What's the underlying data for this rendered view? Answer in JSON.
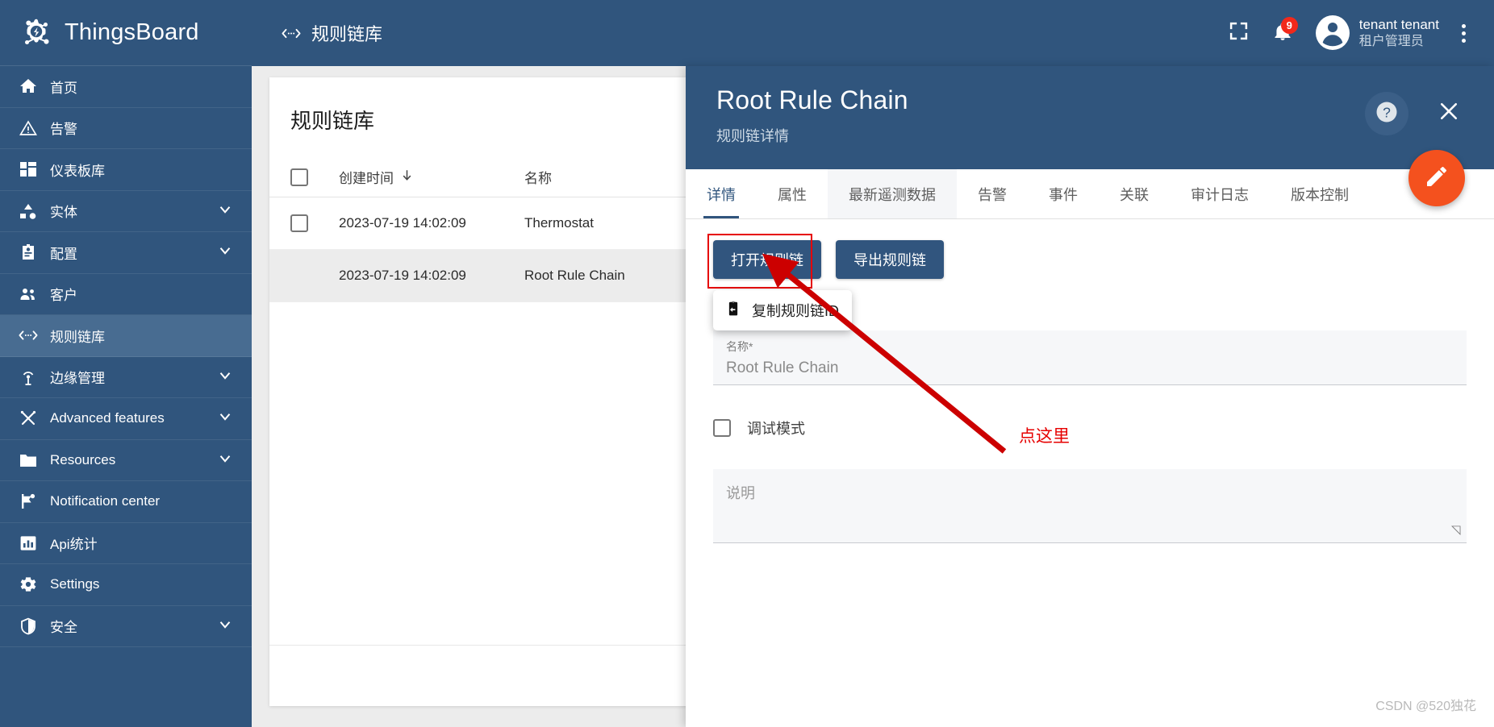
{
  "brand": {
    "name": "ThingsBoard",
    "logo_icon": "thingsboard-logo-icon"
  },
  "sidebar": {
    "items": [
      {
        "label": "首页",
        "icon": "home-icon",
        "expandable": false,
        "active": false
      },
      {
        "label": "告警",
        "icon": "alarm-warning-icon",
        "expandable": false,
        "active": false
      },
      {
        "label": "仪表板库",
        "icon": "dashboards-grid-icon",
        "expandable": false,
        "active": false
      },
      {
        "label": "实体",
        "icon": "entities-icon",
        "expandable": true,
        "active": false
      },
      {
        "label": "配置",
        "icon": "profiles-badge-icon",
        "expandable": true,
        "active": false
      },
      {
        "label": "客户",
        "icon": "customers-people-icon",
        "expandable": false,
        "active": false
      },
      {
        "label": "规则链库",
        "icon": "rule-chain-icon",
        "expandable": false,
        "active": true
      },
      {
        "label": "边缘管理",
        "icon": "edge-antenna-icon",
        "expandable": true,
        "active": false
      },
      {
        "label": "Advanced features",
        "icon": "tools-icon",
        "expandable": true,
        "active": false
      },
      {
        "label": "Resources",
        "icon": "folder-icon",
        "expandable": true,
        "active": false
      },
      {
        "label": "Notification center",
        "icon": "flag-icon",
        "expandable": false,
        "active": false
      },
      {
        "label": "Api统计",
        "icon": "bar-chart-icon",
        "expandable": false,
        "active": false
      },
      {
        "label": "Settings",
        "icon": "gear-icon",
        "expandable": false,
        "active": false
      },
      {
        "label": "安全",
        "icon": "shield-icon",
        "expandable": true,
        "active": false
      }
    ]
  },
  "topbar": {
    "title": "规则链库",
    "title_icon": "rule-chain-icon",
    "fullscreen_icon": "fullscreen-icon",
    "notifications_icon": "bell-icon",
    "notifications_count": "9",
    "avatar_icon": "user-avatar-icon",
    "user_name": "tenant tenant",
    "user_role": "租户管理员",
    "more_icon": "kebab-menu-icon"
  },
  "list_card": {
    "title": "规则链库",
    "columns": [
      "创建时间",
      "名称"
    ],
    "sort_icon": "arrow-down-icon",
    "rows": [
      {
        "created_time": "2023-07-19 14:02:09",
        "name": "Thermostat",
        "selected": false,
        "checkbox": true
      },
      {
        "created_time": "2023-07-19 14:02:09",
        "name": "Root Rule Chain",
        "selected": true,
        "checkbox": false
      }
    ]
  },
  "detail": {
    "title": "Root Rule Chain",
    "subtitle": "规则链详情",
    "help_icon": "help-question-icon",
    "close_icon": "close-icon",
    "edit_fab_icon": "pencil-edit-icon",
    "tabs": [
      {
        "label": "详情",
        "active": true
      },
      {
        "label": "属性",
        "active": false
      },
      {
        "label": "最新遥测数据",
        "active": false,
        "hover": true
      },
      {
        "label": "告警",
        "active": false
      },
      {
        "label": "事件",
        "active": false
      },
      {
        "label": "关联",
        "active": false
      },
      {
        "label": "审计日志",
        "active": false
      },
      {
        "label": "版本控制",
        "active": false
      }
    ],
    "buttons": {
      "open_rule_chain": "打开规则链",
      "export_rule_chain": "导出规则链",
      "copy_rule_chain_id": "复制规则链ID",
      "copy_icon": "clipboard-copy-icon"
    },
    "form": {
      "name_label": "名称*",
      "name_value": "Root Rule Chain",
      "debug_mode_label": "调试模式",
      "debug_mode_checked": false,
      "description_placeholder": "说明",
      "description_value": ""
    }
  },
  "annotation": {
    "text": "点这里",
    "color": "#e60000"
  },
  "watermark": "CSDN @520独花",
  "colors": {
    "brand_blue": "#30557D",
    "sidebar_active": "#486C91",
    "accent_orange": "#F4511E",
    "badge_red": "#F2291B",
    "annotation_red": "#e60000"
  }
}
